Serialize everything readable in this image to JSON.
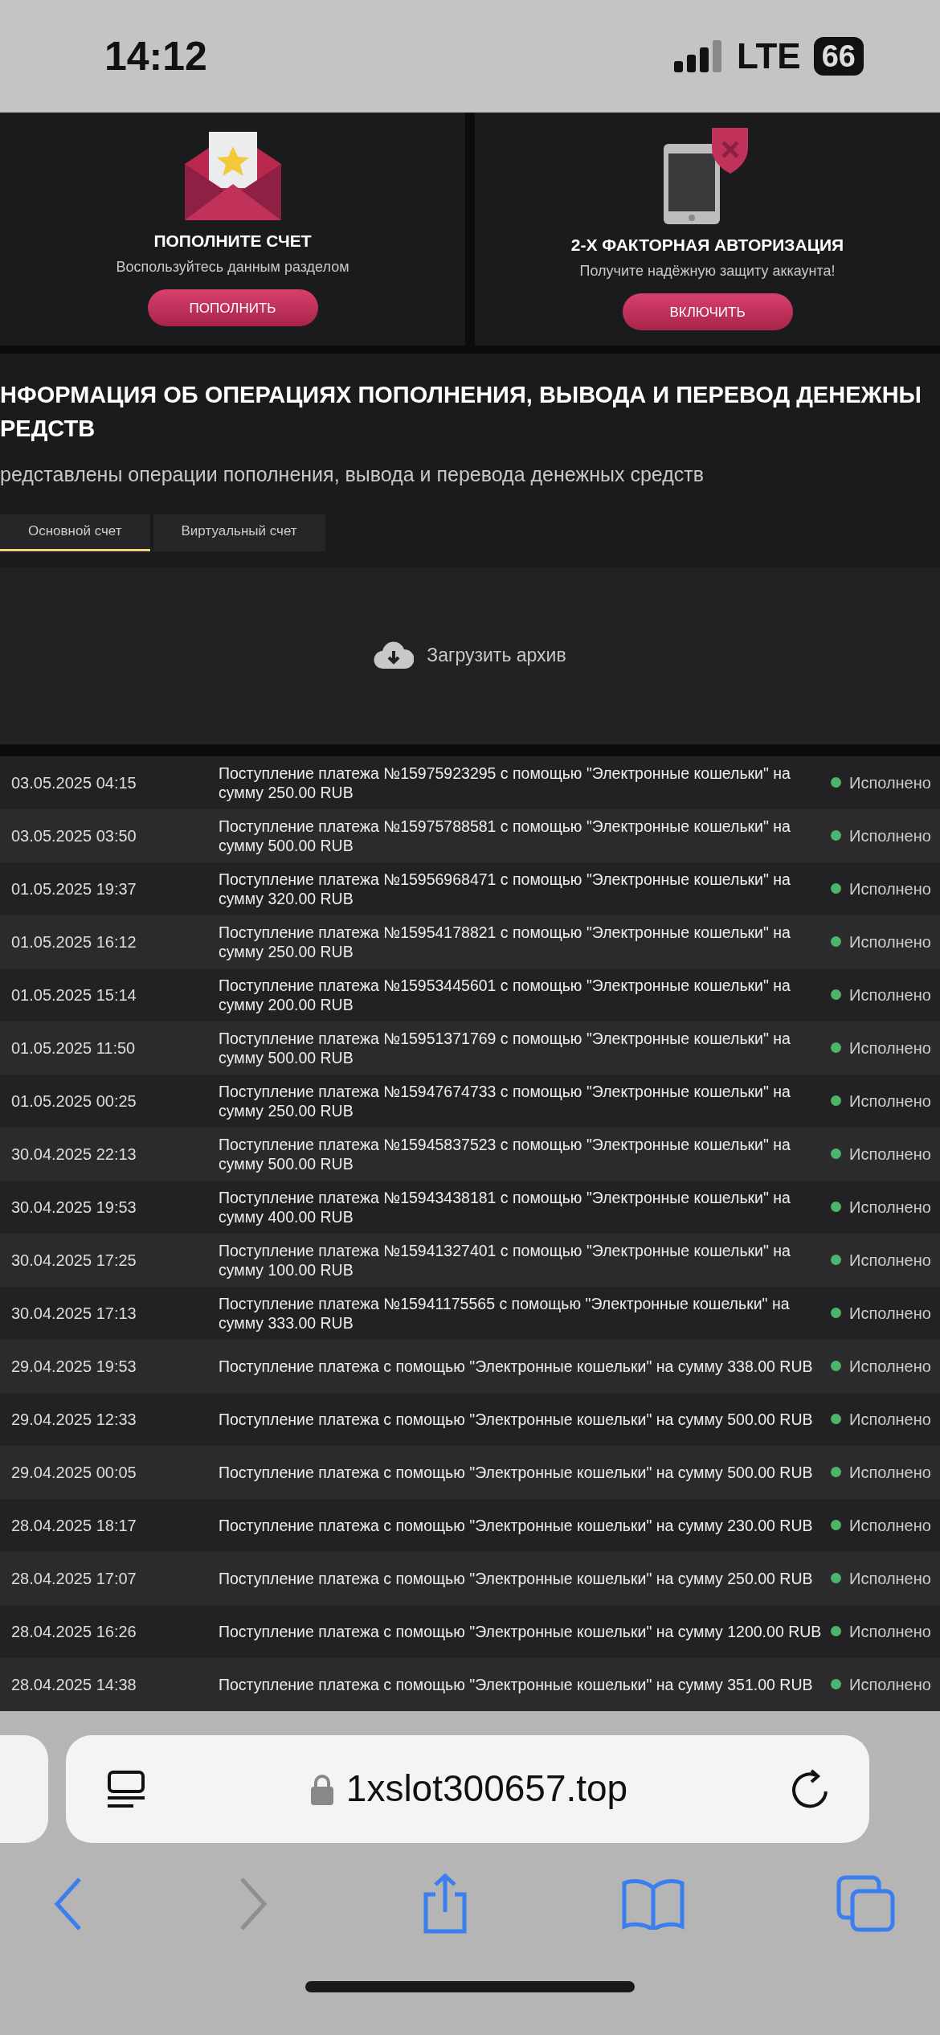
{
  "status_bar": {
    "time": "14:12",
    "network": "LTE",
    "battery": "66"
  },
  "promo_cards": [
    {
      "kind": "deposit",
      "title": "ПОПОЛНИТЕ СЧЕТ",
      "text": "Воспользуйтесь данным разделом",
      "button": "ПОПОЛНИТЬ"
    },
    {
      "kind": "twofactor",
      "title": "2-Х ФАКТОРНАЯ АВТОРИЗАЦИЯ",
      "text": "Получите надёжную защиту аккаунта!",
      "button": "ВКЛЮЧИТЬ"
    }
  ],
  "section": {
    "title_lines": [
      "НФОРМАЦИЯ ОБ ОПЕРАЦИЯХ ПОПОЛНЕНИЯ, ВЫВОДА И ПЕРЕВОД ДЕНЕЖНЫ",
      "РЕДСТВ"
    ],
    "subtitle": "редставлены операции пополнения, вывода и перевода денежных средств"
  },
  "tabs": [
    {
      "label": "Основной счет",
      "selected": true
    },
    {
      "label": "Виртуальный счет",
      "selected": false
    }
  ],
  "archive": {
    "label": "Загрузить архив"
  },
  "rows": [
    {
      "date": "03.05.2025 04:15",
      "description": "Поступление платежа №15975923295 с помощью \"Электронные кошельки\" на сумму 250.00 RUB",
      "status": "Исполнено"
    },
    {
      "date": "03.05.2025 03:50",
      "description": "Поступление платежа №15975788581 с помощью \"Электронные кошельки\" на сумму 500.00 RUB",
      "status": "Исполнено"
    },
    {
      "date": "01.05.2025 19:37",
      "description": "Поступление платежа №15956968471 с помощью \"Электронные кошельки\" на сумму 320.00 RUB",
      "status": "Исполнено"
    },
    {
      "date": "01.05.2025 16:12",
      "description": "Поступление платежа №15954178821 с помощью \"Электронные кошельки\" на сумму 250.00 RUB",
      "status": "Исполнено"
    },
    {
      "date": "01.05.2025 15:14",
      "description": "Поступление платежа №15953445601 с помощью \"Электронные кошельки\" на сумму 200.00 RUB",
      "status": "Исполнено"
    },
    {
      "date": "01.05.2025 11:50",
      "description": "Поступление платежа №15951371769 с помощью \"Электронные кошельки\" на сумму 500.00 RUB",
      "status": "Исполнено"
    },
    {
      "date": "01.05.2025 00:25",
      "description": "Поступление платежа №15947674733 с помощью \"Электронные кошельки\" на сумму 250.00 RUB",
      "status": "Исполнено"
    },
    {
      "date": "30.04.2025 22:13",
      "description": "Поступление платежа №15945837523 с помощью \"Электронные кошельки\" на сумму 500.00 RUB",
      "status": "Исполнено"
    },
    {
      "date": "30.04.2025 19:53",
      "description": "Поступление платежа №15943438181 с помощью \"Электронные кошельки\" на сумму 400.00 RUB",
      "status": "Исполнено"
    },
    {
      "date": "30.04.2025 17:25",
      "description": "Поступление платежа №15941327401 с помощью \"Электронные кошельки\" на сумму 100.00 RUB",
      "status": "Исполнено"
    },
    {
      "date": "30.04.2025 17:13",
      "description": "Поступление платежа №15941175565 с помощью \"Электронные кошельки\" на сумму 333.00 RUB",
      "status": "Исполнено"
    },
    {
      "date": "29.04.2025 19:53",
      "description": "Поступление платежа с помощью \"Электронные кошельки\" на сумму 338.00 RUB",
      "status": "Исполнено"
    },
    {
      "date": "29.04.2025 12:33",
      "description": "Поступление платежа с помощью \"Электронные кошельки\" на сумму 500.00 RUB",
      "status": "Исполнено"
    },
    {
      "date": "29.04.2025 00:05",
      "description": "Поступление платежа с помощью \"Электронные кошельки\" на сумму 500.00 RUB",
      "status": "Исполнено"
    },
    {
      "date": "28.04.2025 18:17",
      "description": "Поступление платежа с помощью \"Электронные кошельки\" на сумму 230.00 RUB",
      "status": "Исполнено"
    },
    {
      "date": "28.04.2025 17:07",
      "description": "Поступление платежа с помощью \"Электронные кошельки\" на сумму 250.00 RUB",
      "status": "Исполнено"
    },
    {
      "date": "28.04.2025 16:26",
      "description": "Поступление платежа с помощью \"Электронные кошельки\" на сумму 1200.00 RUB",
      "status": "Исполнено"
    },
    {
      "date": "28.04.2025 14:38",
      "description": "Поступление платежа с помощью \"Электронные кошельки\" на сумму 351.00 RUB",
      "status": "Исполнено"
    }
  ],
  "browser": {
    "url": "1xslot300657.top",
    "toolbar": [
      {
        "kind": "back",
        "disabled": false
      },
      {
        "kind": "forward",
        "disabled": true
      },
      {
        "kind": "share",
        "disabled": false
      },
      {
        "kind": "bookmarks",
        "disabled": false
      },
      {
        "kind": "tabs",
        "disabled": false
      }
    ]
  }
}
